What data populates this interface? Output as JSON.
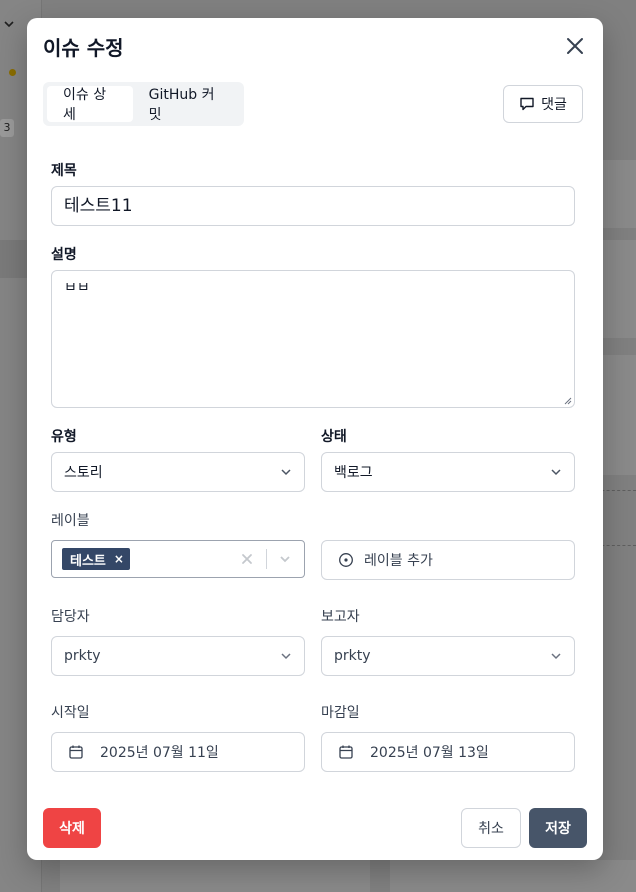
{
  "background": {
    "sidebar_badge_count": "3"
  },
  "modal": {
    "title": "이슈 수정",
    "tabs": [
      {
        "label": "이슈 상세",
        "active": true
      },
      {
        "label": "GitHub 커밋",
        "active": false
      }
    ],
    "comment_button": "댓글",
    "fields": {
      "title_label": "제목",
      "title_value": "테스트11",
      "description_label": "설명",
      "description_value": "ㅂㅂ",
      "type_label": "유형",
      "type_value": "스토리",
      "status_label": "상태",
      "status_value": "백로그",
      "labels_label": "레이블",
      "labels_selected": [
        "테스트"
      ],
      "add_label_button": "레이블 추가",
      "assignee_label": "담당자",
      "assignee_value": "prkty",
      "reporter_label": "보고자",
      "reporter_value": "prkty",
      "start_date_label": "시작일",
      "start_date_value": "2025년 07월 11일",
      "due_date_label": "마감일",
      "due_date_value": "2025년 07월 13일"
    },
    "buttons": {
      "delete": "삭제",
      "cancel": "취소",
      "save": "저장"
    }
  },
  "colors": {
    "delete": "#ef4444",
    "save": "#475569",
    "tag": "#344767"
  }
}
